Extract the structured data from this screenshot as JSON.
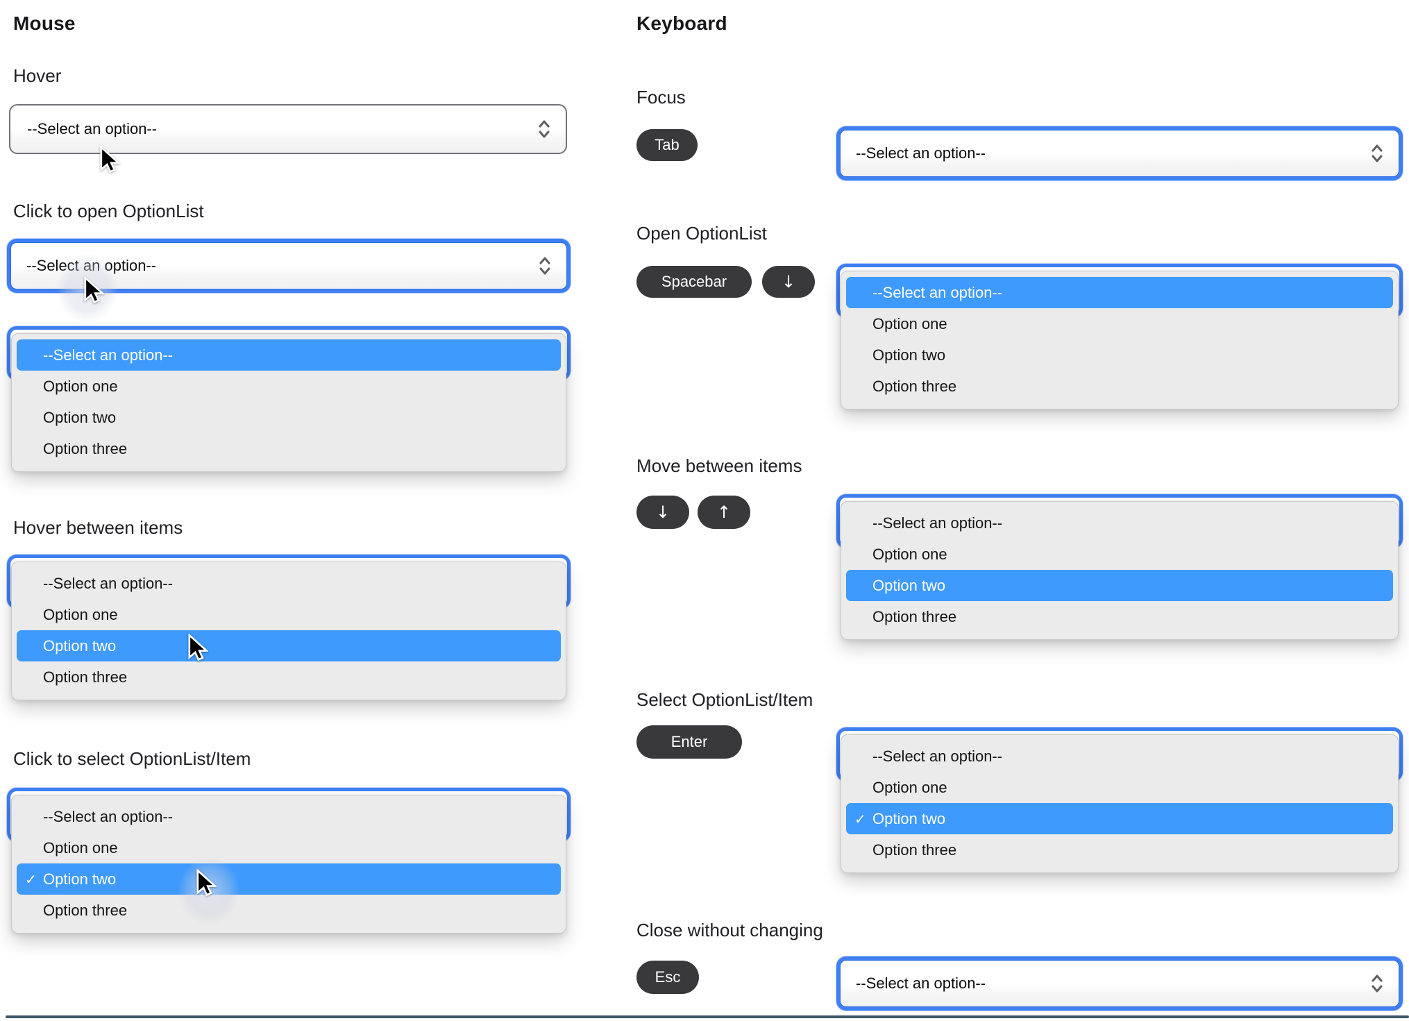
{
  "titles": {
    "mouse": "Mouse",
    "keyboard": "Keyboard"
  },
  "mouse": {
    "hover_label": "Hover",
    "open_label": "Click to open OptionList",
    "hover_items_label": "Hover between items",
    "select_item_label": "Click to select OptionList/Item"
  },
  "keyboard": {
    "focus_label": "Focus",
    "open_label": "Open OptionList",
    "move_label": "Move between items",
    "select_label": "Select OptionList/Item",
    "close_label": "Close without changing"
  },
  "keys": {
    "tab": "Tab",
    "spacebar": "Spacebar",
    "arrow_down": "↓",
    "arrow_up": "↑",
    "enter": "Enter",
    "esc": "Esc"
  },
  "select": {
    "placeholder": "--Select an option--"
  },
  "options": [
    "--Select an option--",
    "Option one",
    "Option two",
    "Option three"
  ],
  "glyphs": {
    "check": "✓"
  },
  "colors": {
    "focus_ring": "#3F7FF3",
    "highlight": "#3E9AFD",
    "panel": "#EBEBEB",
    "key_badge": "#39393C",
    "unfocused_border": "#73737B",
    "bottom_rule": "#3F5666"
  }
}
